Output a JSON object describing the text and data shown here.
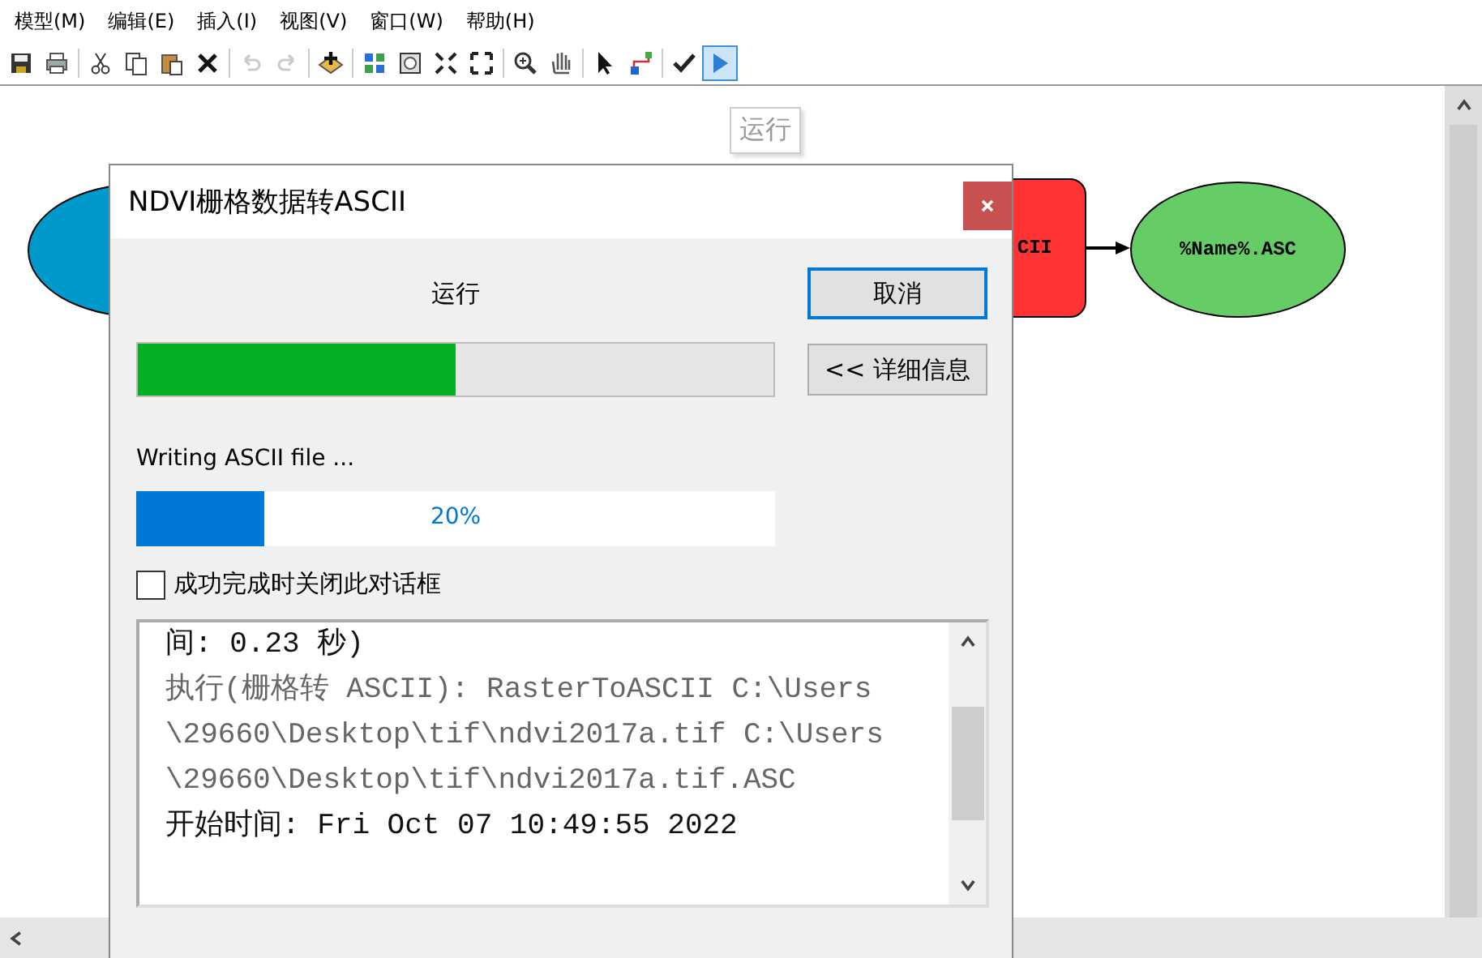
{
  "menu": [
    {
      "label": "模型(M)"
    },
    {
      "label": "编辑(E)"
    },
    {
      "label": "插入(I)"
    },
    {
      "label": "视图(V)"
    },
    {
      "label": "窗口(W)"
    },
    {
      "label": "帮助(H)"
    }
  ],
  "toolbar": [
    {
      "kind": "save",
      "disabled": false,
      "selected": false
    },
    {
      "kind": "print",
      "disabled": false,
      "selected": false
    },
    {
      "kind": "separator"
    },
    {
      "kind": "cut",
      "disabled": false,
      "selected": false
    },
    {
      "kind": "copy",
      "disabled": false,
      "selected": false
    },
    {
      "kind": "paste",
      "disabled": false,
      "selected": false
    },
    {
      "kind": "delete",
      "disabled": false,
      "selected": false
    },
    {
      "kind": "separator"
    },
    {
      "kind": "undo",
      "disabled": true,
      "selected": false
    },
    {
      "kind": "redo",
      "disabled": true,
      "selected": false
    },
    {
      "kind": "separator"
    },
    {
      "kind": "add",
      "disabled": false,
      "selected": false
    },
    {
      "kind": "separator"
    },
    {
      "kind": "layout",
      "disabled": false,
      "selected": false
    },
    {
      "kind": "fit",
      "disabled": false,
      "selected": false
    },
    {
      "kind": "shrink",
      "disabled": false,
      "selected": false
    },
    {
      "kind": "expand",
      "disabled": false,
      "selected": false
    },
    {
      "kind": "separator"
    },
    {
      "kind": "zoom",
      "disabled": false,
      "selected": false
    },
    {
      "kind": "pan",
      "disabled": false,
      "selected": false
    },
    {
      "kind": "separator"
    },
    {
      "kind": "pointer",
      "disabled": false,
      "selected": false
    },
    {
      "kind": "connect",
      "disabled": false,
      "selected": false
    },
    {
      "kind": "separator"
    },
    {
      "kind": "validate",
      "disabled": false,
      "selected": false
    },
    {
      "kind": "run",
      "disabled": false,
      "selected": true
    }
  ],
  "tooltip": "运行",
  "diagram": {
    "nodes": [
      {
        "kind": "input",
        "color": "#0099cc"
      },
      {
        "kind": "tool",
        "label": "CII",
        "color": "#ff3333"
      },
      {
        "kind": "output",
        "label": "%Name%.ASC",
        "color": "#66cc66"
      }
    ]
  },
  "dialog": {
    "title": "NDVI栅格数据转ASCII",
    "status": "运行",
    "cancel_button": "取消",
    "details_button": "<< 详细信息",
    "overall_progress": {
      "level": 0.5
    },
    "step_message": "Writing ASCII file ...",
    "step_progress": {
      "level": 0.2,
      "reading": "20%"
    },
    "close_checkbox": {
      "label": "成功完成时关闭此对话框",
      "checked": false
    },
    "log": [
      {
        "kind": "message",
        "text": "间: 0.23 秒)"
      },
      {
        "kind": "command",
        "text": "执行(栅格转 ASCII): RasterToASCII C:\\Users"
      },
      {
        "kind": "command",
        "text": "\\29660\\Desktop\\tif\\ndvi2017a.tif C:\\Users"
      },
      {
        "kind": "command",
        "text": "\\29660\\Desktop\\tif\\ndvi2017a.tif.ASC"
      },
      {
        "kind": "message",
        "text": "开始时间: Fri Oct 07 10:49:55 2022"
      }
    ]
  }
}
